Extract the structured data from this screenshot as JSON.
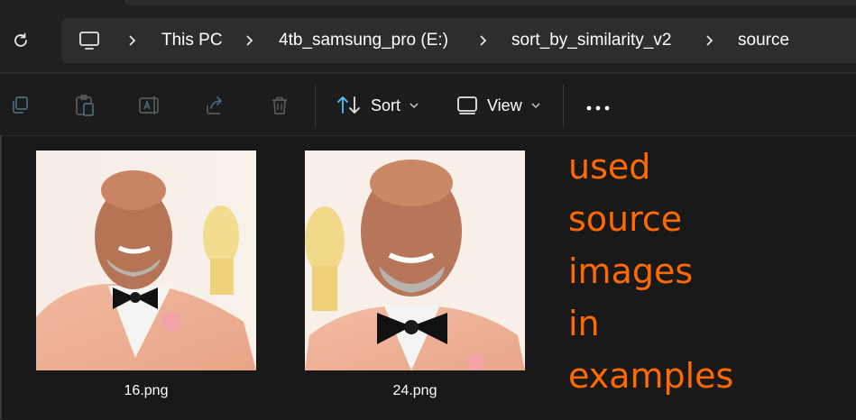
{
  "breadcrumb": {
    "items": [
      "This PC",
      "4tb_samsung_pro (E:)",
      "sort_by_similarity_v2",
      "source"
    ]
  },
  "toolbar": {
    "sort_label": "Sort",
    "view_label": "View",
    "icons": [
      "copy-icon",
      "paste-icon",
      "rename-icon",
      "share-icon",
      "delete-icon"
    ]
  },
  "files": [
    {
      "name": "16.png"
    },
    {
      "name": "24.png"
    }
  ],
  "annotation": {
    "lines": [
      "used",
      "source",
      "images",
      "in",
      "examples"
    ],
    "color": "#ff6a00"
  },
  "colors": {
    "accent": "#4cc2ff",
    "background": "#191919",
    "address_bg": "#2d2d2d"
  }
}
